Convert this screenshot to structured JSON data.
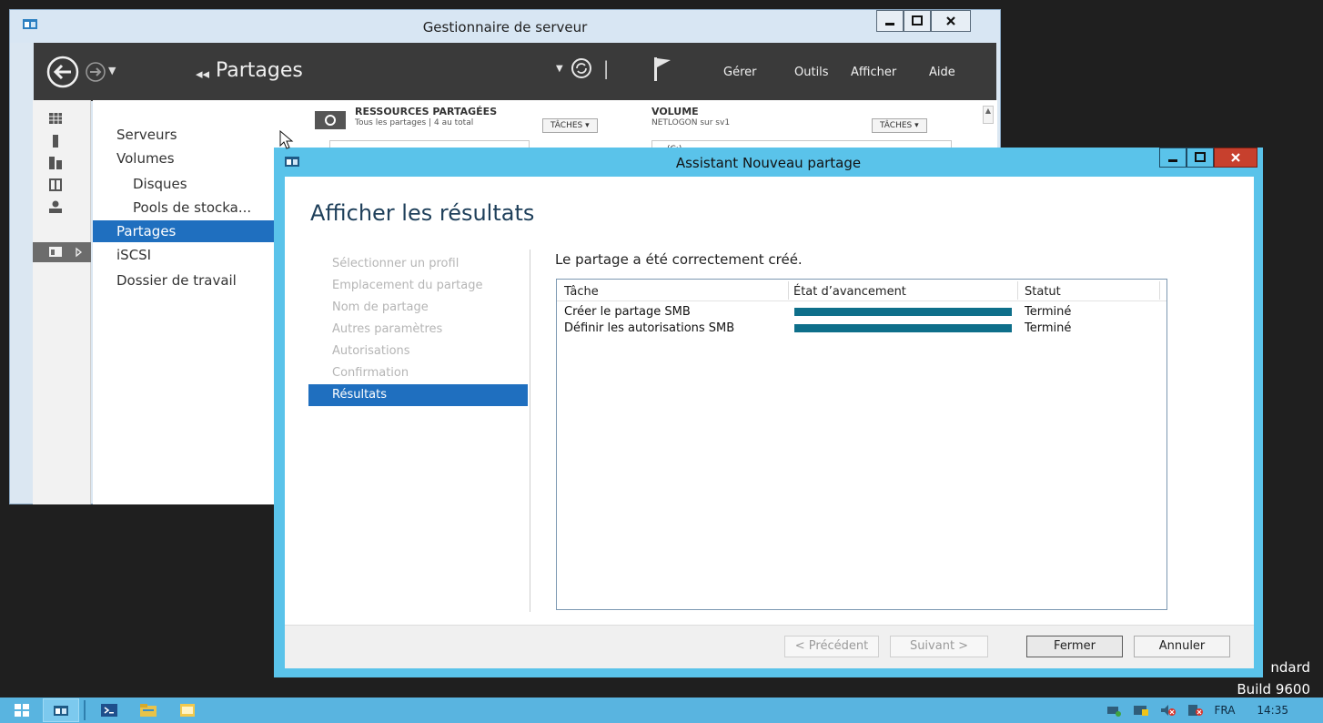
{
  "desktop": {
    "watermark_line1": "ndard",
    "watermark_line2": "Build 9600"
  },
  "taskbar": {
    "apps": [
      "start-icon",
      "server-manager-icon",
      "powershell-icon",
      "file-explorer-icon",
      "folder-icon"
    ],
    "tray_language": "FRA",
    "tray_time": "14:35"
  },
  "server_manager": {
    "title": "Gestionnaire de serveur",
    "breadcrumb": "Partages",
    "menu": [
      "Gérer",
      "Outils",
      "Afficher",
      "Aide"
    ],
    "nav": [
      {
        "label": "Serveurs"
      },
      {
        "label": "Volumes"
      },
      {
        "label": "Disques"
      },
      {
        "label": "Pools de stocka..."
      },
      {
        "label": "Partages"
      },
      {
        "label": "iSCSI"
      },
      {
        "label": "Dossier de travail"
      }
    ],
    "resources_title": "RESSOURCES PARTAGÉES",
    "resources_subtitle": "Tous les partages | 4 au total",
    "tasks_label": "TÂCHES",
    "volume_title": "VOLUME",
    "volume_subtitle": "NETLOGON sur sv1",
    "volume_partial": "(C:)"
  },
  "wizard": {
    "title": "Assistant Nouveau partage",
    "heading": "Afficher les résultats",
    "steps": [
      "Sélectionner un profil",
      "Emplacement du partage",
      "Nom de partage",
      "Autres paramètres",
      "Autorisations",
      "Confirmation",
      "Résultats"
    ],
    "message": "Le partage a été correctement créé.",
    "columns": [
      "Tâche",
      "État d’avancement",
      "Statut"
    ],
    "rows": [
      {
        "task": "Créer le partage SMB",
        "progress": 1.0,
        "status": "Terminé"
      },
      {
        "task": "Définir les autorisations SMB",
        "progress": 1.0,
        "status": "Terminé"
      }
    ],
    "buttons": {
      "previous": "< Précédent",
      "next": "Suivant >",
      "close": "Fermer",
      "cancel": "Annuler"
    }
  }
}
